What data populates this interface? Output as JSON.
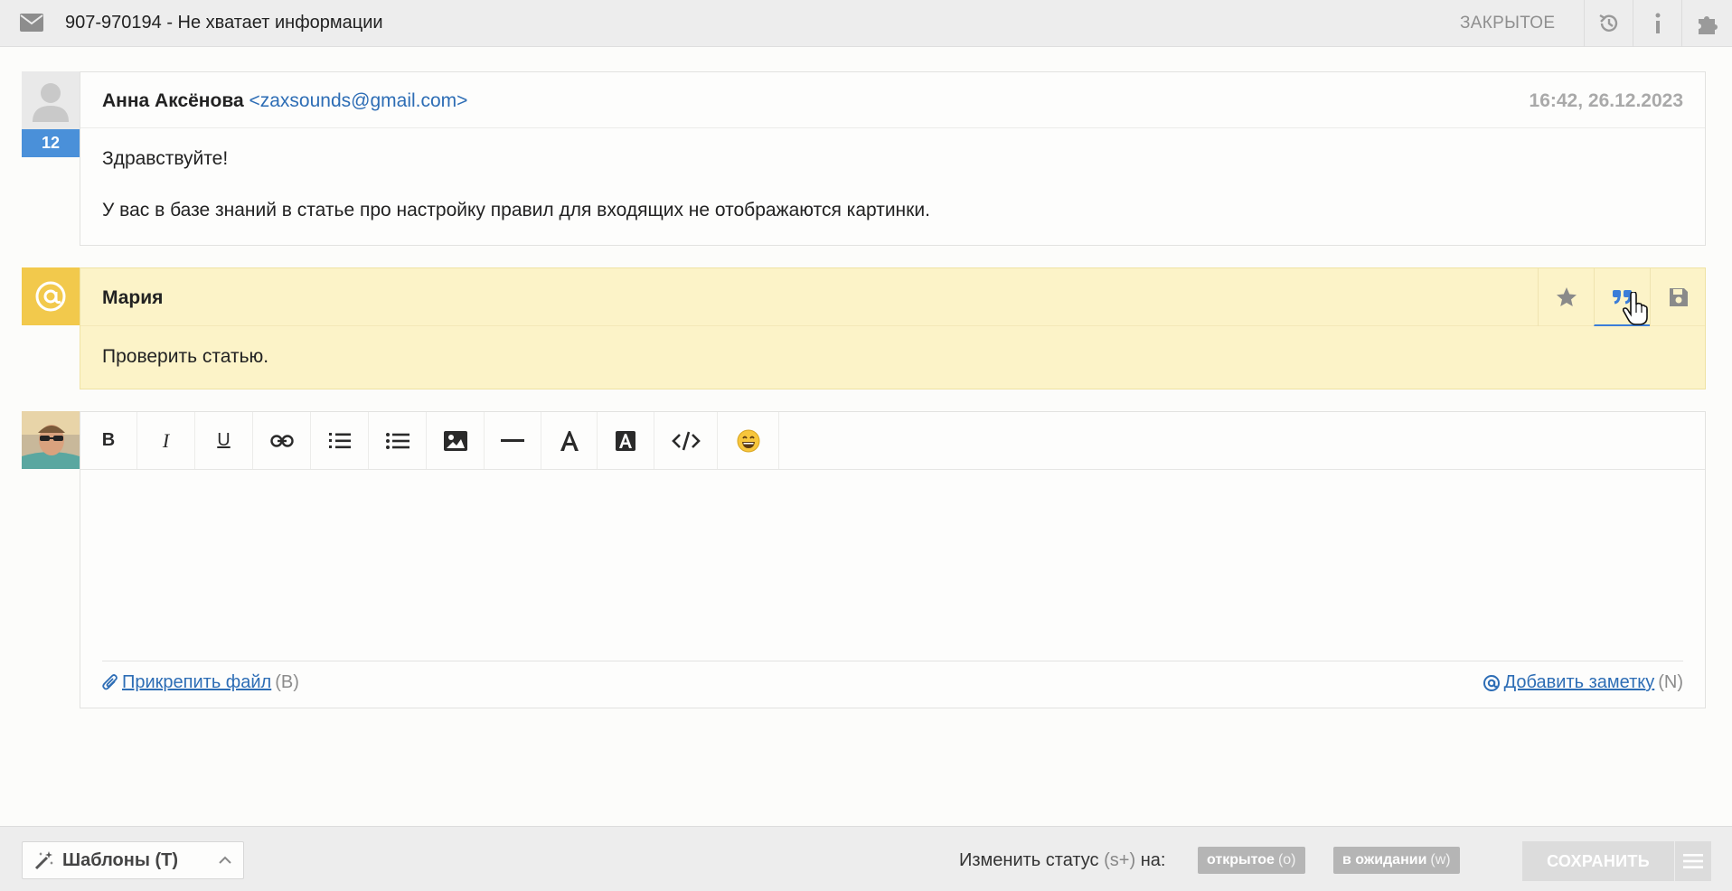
{
  "header": {
    "title": "907-970194 - Не хватает информации",
    "status": "ЗАКРЫТОЕ",
    "icons": [
      "mail-icon",
      "history-icon",
      "info-icon",
      "puzzle-icon"
    ]
  },
  "message": {
    "sender_name": "Анна Аксёнова",
    "sender_email": "<zaxsounds@gmail.com>",
    "date": "16:42, 26.12.2023",
    "counter": "12",
    "body": [
      "Здравствуйте!",
      "У вас в базе знаний в статье про настройку правил для входящих не отображаются картинки."
    ]
  },
  "note": {
    "author": "Мария",
    "text": "Проверить статью.",
    "actions": [
      "star-icon",
      "quote-icon",
      "save-icon"
    ]
  },
  "editor": {
    "toolbar": [
      "bold",
      "italic",
      "underline",
      "link",
      "numbered-list",
      "bullet-list",
      "image",
      "horizontal-rule",
      "text-color",
      "background-color",
      "code",
      "emoji"
    ],
    "bold_label": "B",
    "italic_label": "I",
    "underline_label": "U",
    "attach_label": "Прикрепить файл",
    "attach_hotkey": "(B)",
    "add_note_label": "Добавить заметку",
    "add_note_hotkey": "(N)"
  },
  "footer": {
    "templates_label": "Шаблоны (T)",
    "change_status_label": "Изменить статус",
    "change_status_hotkey": "(s+)",
    "change_status_on": "на:",
    "status_open": "открытое",
    "status_open_hotkey": "(o)",
    "status_waiting": "в ожидании",
    "status_waiting_hotkey": "(w)",
    "save_label": "СОХРАНИТЬ"
  },
  "colors": {
    "accent": "#2d6db5",
    "note_bg": "#fcf3c8",
    "note_marker": "#f2c94c",
    "counter_bg": "#4a90d9"
  }
}
